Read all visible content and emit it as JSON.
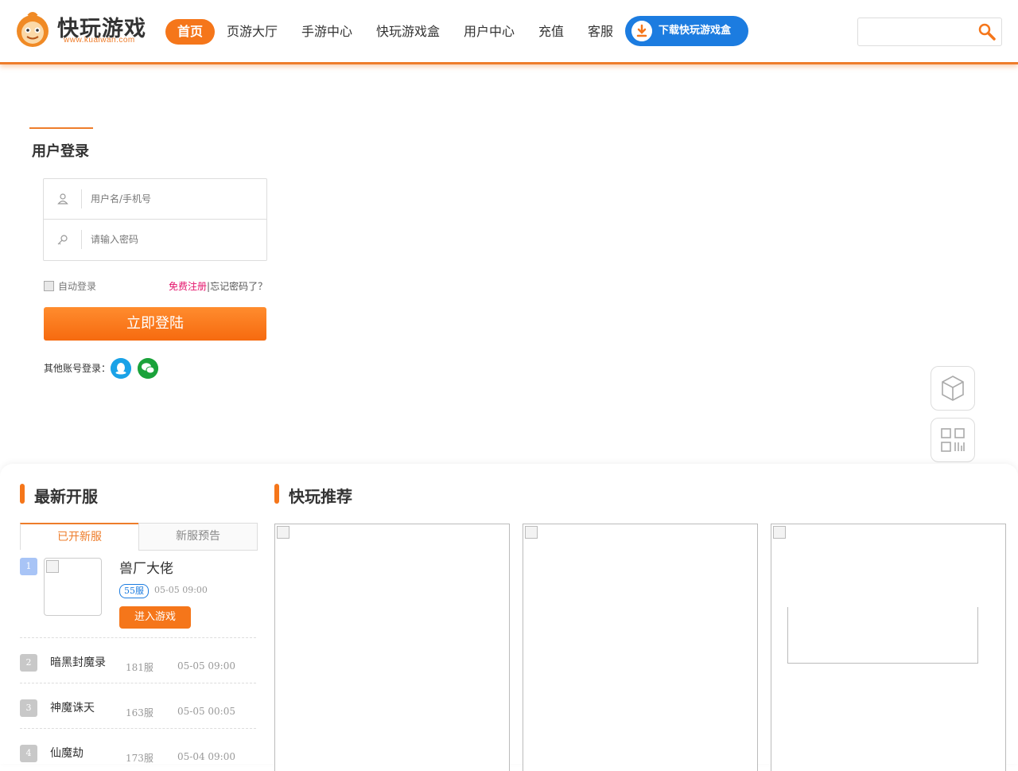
{
  "header": {
    "logo_text": "快玩游戏",
    "logo_url": "www.kuaiwan.com",
    "nav": [
      "首页",
      "页游大厅",
      "手游中心",
      "快玩游戏盒",
      "用户中心",
      "充值",
      "客服"
    ],
    "download_label": "下载快玩游戏盒",
    "search_placeholder": ""
  },
  "login": {
    "title": "用户登录",
    "username_placeholder": "用户名/手机号",
    "password_placeholder": "请输入密码",
    "auto_login": "自动登录",
    "register": "免费注册",
    "separator": "|",
    "forgot": "忘记密码了？",
    "submit": "立即登陆",
    "other_login": "其他账号登录："
  },
  "servers": {
    "title": "最新开服",
    "tabs": [
      "已开新服",
      "新服预告"
    ],
    "featured": {
      "rank": "1",
      "name": "兽厂大佬",
      "server": "55服",
      "time": "05-05 09:00",
      "enter": "进入游戏"
    },
    "list": [
      {
        "rank": "2",
        "name": "暗黑封魔录",
        "server": "181服",
        "time": "05-05 09:00"
      },
      {
        "rank": "3",
        "name": "神魔诛天",
        "server": "163服",
        "time": "05-05 00:05"
      },
      {
        "rank": "4",
        "name": "仙魔劫",
        "server": "173服",
        "time": "05-04 09:00"
      }
    ]
  },
  "recommend": {
    "title": "快玩推荐"
  },
  "colors": {
    "accent": "#f5761a",
    "blue": "#1c7ce0",
    "register": "#e4146b"
  }
}
